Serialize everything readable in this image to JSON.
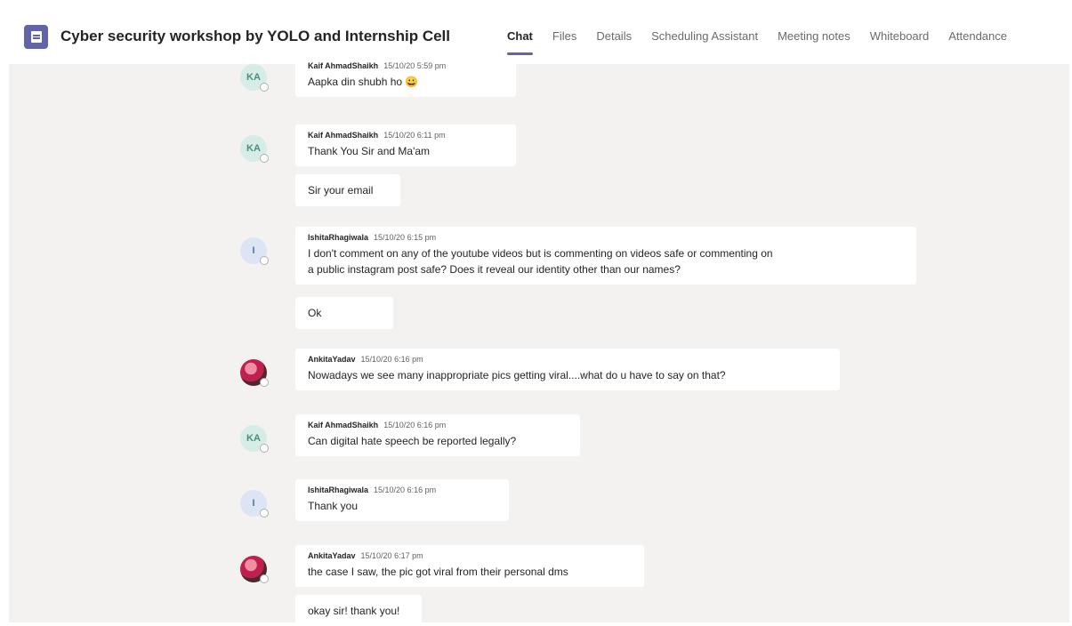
{
  "header": {
    "title": "Cyber security workshop by YOLO and Internship Cell",
    "tabs": [
      "Chat",
      "Files",
      "Details",
      "Scheduling Assistant",
      "Meeting notes",
      "Whiteboard",
      "Attendance"
    ]
  },
  "colors": {
    "accent": "#6264a7",
    "background": "#f3f2f1"
  },
  "messages": [
    {
      "author": "Kaif AhmadShaikh",
      "time": "15/10/20 5:59 pm",
      "avatar": "KA",
      "lines": [
        "Aapka din shubh ho 😀"
      ]
    },
    {
      "author": "Kaif AhmadShaikh",
      "time": "15/10/20 6:11 pm",
      "avatar": "KA",
      "lines": [
        "Thank You Sir and Ma'am"
      ]
    },
    {
      "author": "",
      "time": "",
      "lines": [
        "Sir your email"
      ]
    },
    {
      "author": "IshitaRhagiwala",
      "time": "15/10/20 6:15 pm",
      "avatar": "I",
      "lines": [
        "I don't comment on any of the youtube videos but is commenting on videos safe or commenting on",
        "a public instagram post safe? Does it reveal our identity other than our names?"
      ]
    },
    {
      "author": "",
      "time": "",
      "lines": [
        "Ok"
      ]
    },
    {
      "author": "AnkitaYadav",
      "time": "15/10/20 6:16 pm",
      "avatar": "",
      "lines": [
        "Nowadays we see many inappropriate pics getting viral....what do u have to say on that?"
      ]
    },
    {
      "author": "Kaif AhmadShaikh",
      "time": "15/10/20 6:16 pm",
      "avatar": "KA",
      "lines": [
        "Can digital hate speech be reported legally?"
      ]
    },
    {
      "author": "IshitaRhagiwala",
      "time": "15/10/20 6:16 pm",
      "avatar": "I",
      "lines": [
        "Thank you"
      ]
    },
    {
      "author": "AnkitaYadav",
      "time": "15/10/20 6:17 pm",
      "avatar": "",
      "lines": [
        "the case I saw, the pic got viral from their personal dms"
      ]
    },
    {
      "author": "",
      "time": "",
      "lines": [
        "okay sir! thank you!"
      ]
    }
  ]
}
